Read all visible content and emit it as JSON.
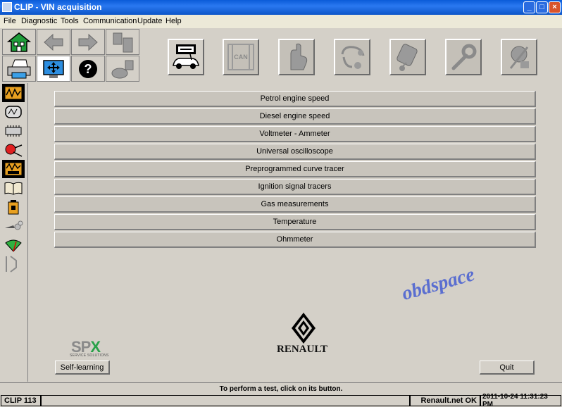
{
  "window": {
    "title": "CLIP - VIN acquisition"
  },
  "menu": [
    "File",
    "Diagnostic",
    "Tools",
    "Communication",
    "Update",
    "Help"
  ],
  "toolbar": {
    "nav_icons": [
      "home-icon",
      "back-arrow-icon",
      "forward-arrow-icon",
      "document-icon",
      "printer-icon",
      "screen-expand-icon",
      "help-icon",
      "car-parts-icon"
    ],
    "tools": [
      "vehicle-diagnostic-icon",
      "can-bus-icon",
      "manual-test-icon",
      "stethoscope-icon",
      "diagnostic-probe-icon",
      "wrench-icon",
      "parts-icon"
    ],
    "can_label": "CAN"
  },
  "sidebar": [
    "oscilloscope-icon",
    "multimeter-icon",
    "ecu-chip-icon",
    "injector-icon",
    "oscilloscope-obd-icon",
    "book-icon",
    "battery-icon",
    "exhaust-gas-icon",
    "gauge-icon",
    "connector-icon"
  ],
  "tests": [
    "Petrol engine speed",
    "Diesel engine speed",
    "Voltmeter - Ammeter",
    "Universal oscilloscope",
    "Preprogrammed curve tracer",
    "Ignition signal tracers",
    "Gas measurements",
    "Temperature",
    "Ohmmeter"
  ],
  "branding": {
    "spx_main": "SP",
    "spx_x": "X",
    "spx_sub": "SERVICE SOLUTIONS",
    "renault": "RENAULT",
    "watermark": "obdspace"
  },
  "buttons": {
    "self_learning": "Self-learning",
    "quit": "Quit"
  },
  "status": {
    "message": "To perform a test, click on its button.",
    "clip": "CLIP 113",
    "network": "Renault.net OK",
    "datetime": "2011-10-24 11:31:23 PM"
  },
  "colors": {
    "title_bar": "#0a5bd8",
    "spx_green": "#2aa14a",
    "watermark": "#5a6ed0"
  }
}
